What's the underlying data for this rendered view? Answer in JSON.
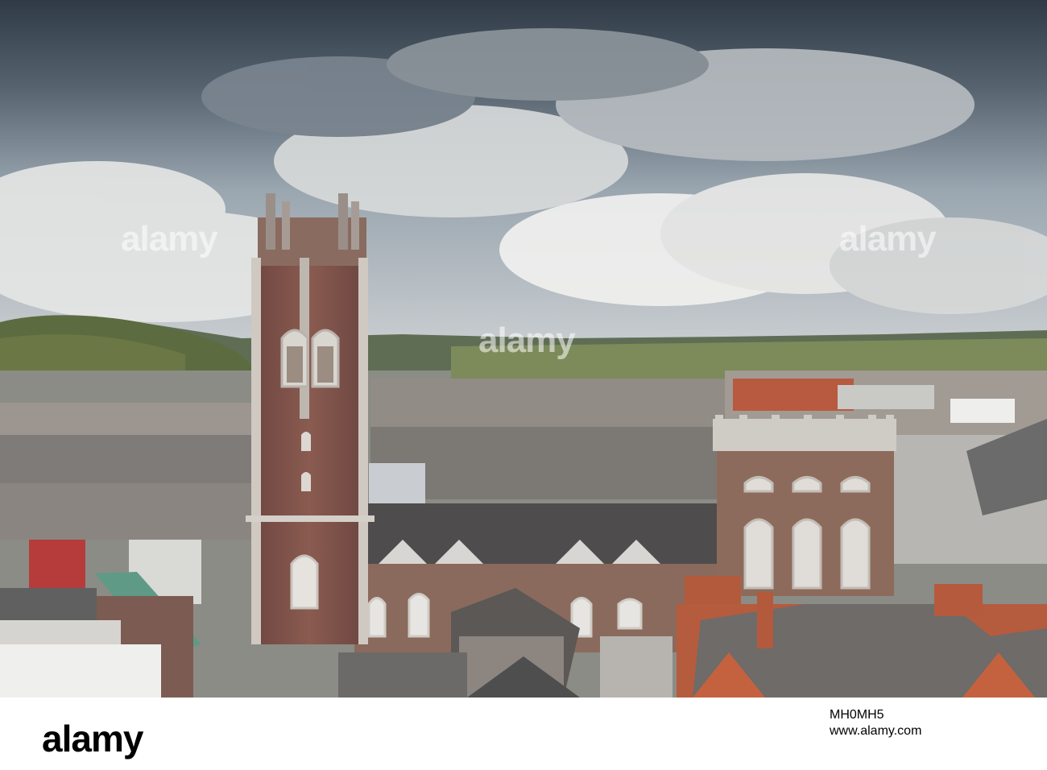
{
  "watermark": {
    "text": "alamy"
  },
  "footer": {
    "logo": "alamy",
    "image_id": "MH0MH5",
    "site": "www.alamy.com"
  }
}
